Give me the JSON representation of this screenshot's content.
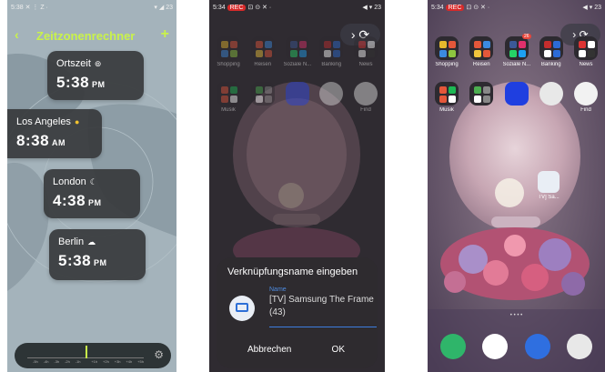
{
  "panel1": {
    "status_left": "5:38 ✕ ⋮ Z ·",
    "status_right": "▾ ◢ 23",
    "back": "‹",
    "title": "Zeitzonenrechner",
    "add": "+",
    "cards": [
      {
        "city": "Ortszeit",
        "icon": "⊚",
        "time": "5:38",
        "suffix": "PM"
      },
      {
        "city": "Los Angeles",
        "icon": "●",
        "time": "8:38",
        "suffix": "AM"
      },
      {
        "city": "London",
        "icon": "☾",
        "time": "4:38",
        "suffix": "PM"
      },
      {
        "city": "Berlin",
        "icon": "☁",
        "time": "5:38",
        "suffix": "PM"
      }
    ],
    "slider_nums": [
      "-5h",
      "-4h",
      "-3h",
      "-2h",
      "-1h",
      "",
      "+1h",
      "+2h",
      "+3h",
      "+4h",
      "+5h"
    ],
    "gear": "⚙"
  },
  "panel2": {
    "status_left": "5:34",
    "status_rec": "REC",
    "status_icons": "⊡ ⊙ ✕ ·",
    "status_right": "◀ ▾ 23",
    "apps_row1": [
      "Shopping",
      "Reisen",
      "Soziale N...",
      "Banking",
      "News"
    ],
    "apps_row2": [
      "Musik",
      "",
      "",
      "",
      "Find"
    ],
    "dialog": {
      "title": "Verknüpfungsname eingeben",
      "hint": "Name",
      "value": "[TV] Samsung The Frame (43)",
      "cancel": "Abbrechen",
      "ok": "OK"
    },
    "pill": "›  ⟳"
  },
  "panel3": {
    "status_left": "5:34",
    "status_rec": "REC",
    "status_icons": "⊡ ⊙ ✕ ·",
    "status_right": "◀ ▾ 23",
    "apps_row1": [
      "Shopping",
      "Reisen",
      "Soziale N...",
      "Banking",
      "News"
    ],
    "apps_row2": [
      "Musik",
      "",
      "",
      "",
      "Find"
    ],
    "tv_label": "TV] Sa...",
    "badge": "26",
    "pill": "›  ⟳",
    "page_dots": "• • • •"
  },
  "colors": {
    "accent": "#c9f24a",
    "link": "#3d7de0"
  }
}
